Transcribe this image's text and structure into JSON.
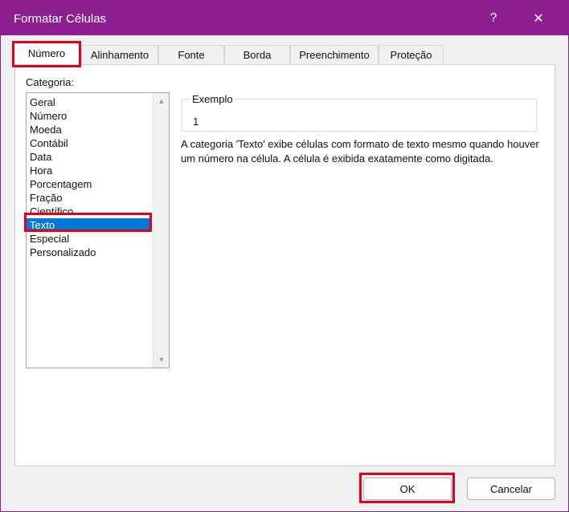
{
  "window": {
    "title": "Formatar Células",
    "accent": "#8c1e8f",
    "highlight": "#e3001b"
  },
  "titlebar": {
    "help_label": "?",
    "close_label": "✕"
  },
  "tabs": [
    {
      "label": "Número",
      "active": true
    },
    {
      "label": "Alinhamento",
      "active": false
    },
    {
      "label": "Fonte",
      "active": false
    },
    {
      "label": "Borda",
      "active": false
    },
    {
      "label": "Preenchimento",
      "active": false
    },
    {
      "label": "Proteção",
      "active": false
    }
  ],
  "category": {
    "label": "Categoria:",
    "items": [
      "Geral",
      "Número",
      "Moeda",
      "Contábil",
      "Data",
      "Hora",
      "Porcentagem",
      "Fração",
      "Científico",
      "Texto",
      "Especial",
      "Personalizado"
    ],
    "selected": "Texto"
  },
  "sample": {
    "legend": "Exemplo",
    "value": "1"
  },
  "description": "A categoria 'Texto' exibe células com formato de texto mesmo quando houver um número na célula. A célula é exibida exatamente como digitada.",
  "buttons": {
    "ok": "OK",
    "cancel": "Cancelar"
  }
}
